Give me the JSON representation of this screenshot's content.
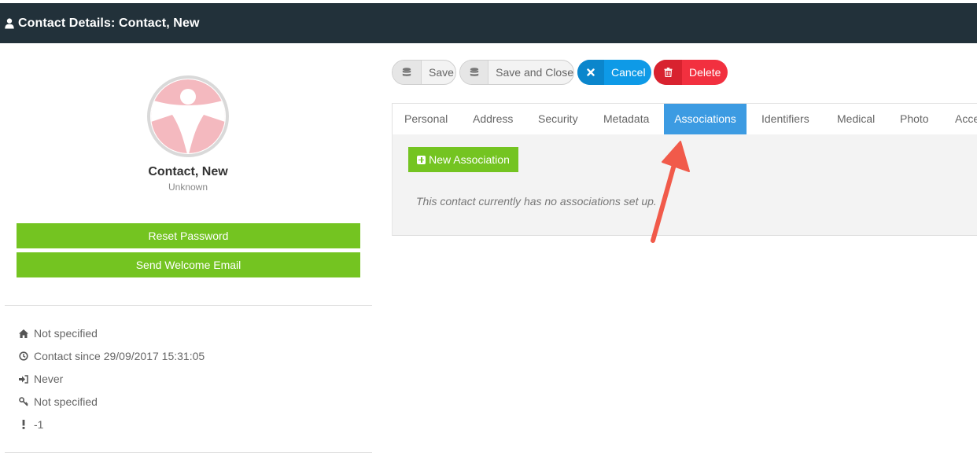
{
  "header": {
    "title": "Contact Details: Contact, New",
    "icon": "user-icon"
  },
  "profile": {
    "name": "Contact, New",
    "status": "Unknown",
    "avatar_colors": {
      "ring": "#d9d9d9",
      "fill": "#f4b9bf"
    }
  },
  "actions": {
    "reset_password": "Reset Password",
    "send_welcome": "Send Welcome Email"
  },
  "info": [
    {
      "icon": "home-icon",
      "text": "Not specified"
    },
    {
      "icon": "clock-icon",
      "text": "Contact since 29/09/2017 15:31:05"
    },
    {
      "icon": "sign-in-icon",
      "text": "Never"
    },
    {
      "icon": "key-icon",
      "text": "Not specified"
    },
    {
      "icon": "exclamation-icon",
      "text": "-1"
    }
  ],
  "toolbar": {
    "save": "Save",
    "save_close": "Save and Close",
    "cancel": "Cancel",
    "delete": "Delete"
  },
  "tabs": [
    "Personal",
    "Address",
    "Security",
    "Metadata",
    "Associations",
    "Identifiers",
    "Medical",
    "Photo",
    "Acce"
  ],
  "active_tab": "Associations",
  "associations": {
    "new_label": "New Association",
    "empty_message": "This contact currently has no associations set up."
  },
  "colors": {
    "header_bg": "#22313a",
    "green": "#74c421",
    "blue": "#0e9ae7",
    "red": "#f2303f",
    "tab_active": "#3c9be2",
    "arrow": "#f15a4a"
  }
}
